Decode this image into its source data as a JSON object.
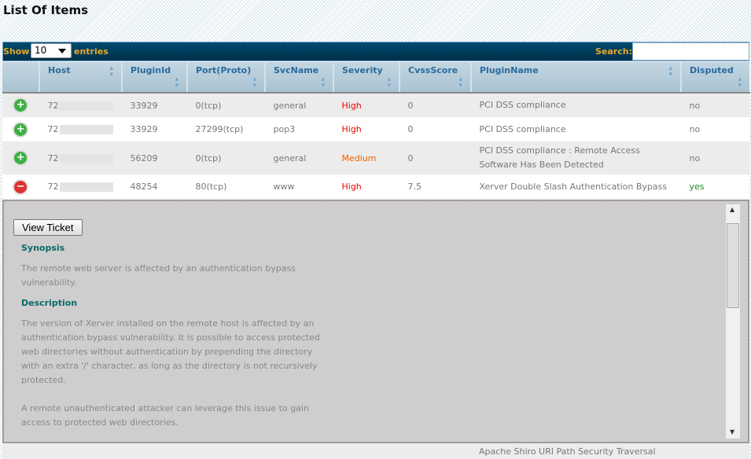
{
  "title": "List Of Items",
  "controls": {
    "show": "Show",
    "entries_value": "10",
    "entries": "entries",
    "search_label": "Search:",
    "search_value": ""
  },
  "columns": [
    "Host",
    "PluginId",
    "Port(Proto)",
    "SvcName",
    "Severity",
    "CvssScore",
    "PluginName",
    "Disputed"
  ],
  "rows": [
    {
      "expand": "plus",
      "host": "72",
      "plugin_id": "33929",
      "port": "0(tcp)",
      "svc": "general",
      "severity": "High",
      "cvss": "0",
      "plugin_name": "PCI DSS compliance",
      "disputed": "no"
    },
    {
      "expand": "plus",
      "host": "72",
      "plugin_id": "33929",
      "port": "27299(tcp)",
      "svc": "pop3",
      "severity": "High",
      "cvss": "0",
      "plugin_name": "PCI DSS compliance",
      "disputed": "no"
    },
    {
      "expand": "plus",
      "host": "72",
      "plugin_id": "56209",
      "port": "0(tcp)",
      "svc": "general",
      "severity": "Medium",
      "cvss": "0",
      "plugin_name": "PCI DSS compliance : Remote Access Software Has Been Detected",
      "disputed": "no"
    },
    {
      "expand": "minus",
      "host": "72",
      "plugin_id": "48254",
      "port": "80(tcp)",
      "svc": "www",
      "severity": "High",
      "cvss": "7.5",
      "plugin_name": "Xerver Double Slash Authentication Bypass",
      "disputed": "yes"
    }
  ],
  "detail": {
    "button": "View Ticket",
    "synopsis_h": "Synopsis",
    "synopsis": "The remote web server is affected by an authentication bypass vulnerability.",
    "description_h": "Description",
    "description1": "The version of Xerver installed on the remote host is affected by an authentication bypass vulnerability. It is possible to access protected web directories without authentication by prepending the directory with an extra '/' character, as long as the directory is not recursively protected.",
    "description2": "A remote unauthenticated attacker can leverage this issue to gain access to protected web directories."
  },
  "partial_row": {
    "plugin_name": "Apache Shiro URI Path Security Traversal"
  },
  "colors": {
    "high": "#ee0000",
    "medium": "#f06000",
    "header_bar": "#004a70",
    "accent": "#e8a825"
  }
}
